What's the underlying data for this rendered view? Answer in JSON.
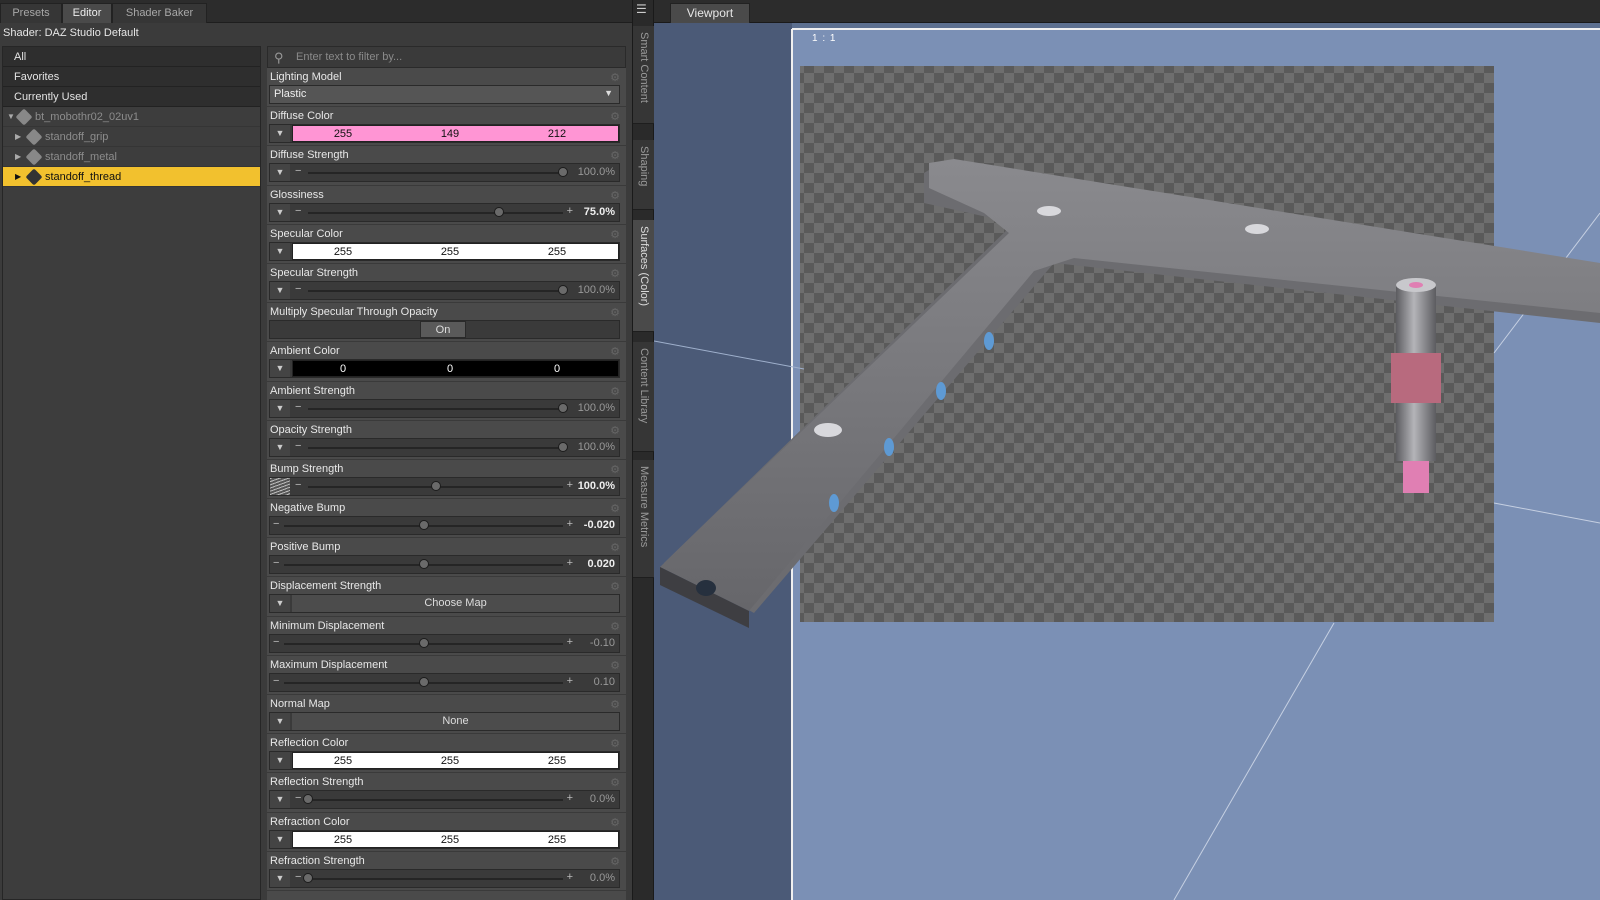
{
  "tabs": [
    "Presets",
    "Editor",
    "Shader Baker"
  ],
  "shader_label": "Shader: DAZ Studio Default",
  "categories": [
    "All",
    "Favorites",
    "Currently Used"
  ],
  "tree": [
    {
      "label": "bt_mobothr02_02uv1"
    },
    {
      "label": "standoff_grip"
    },
    {
      "label": "standoff_metal"
    },
    {
      "label": "standoff_thread"
    }
  ],
  "filter_placeholder": "Enter text to filter by...",
  "properties": {
    "lighting_model": {
      "label": "Lighting Model",
      "value": "Plastic"
    },
    "diffuse_color": {
      "label": "Diffuse Color",
      "r": "255",
      "g": "149",
      "b": "212",
      "color": "#ff95d4"
    },
    "diffuse_strength": {
      "label": "Diffuse Strength",
      "value": "100.0%",
      "level": 1.0
    },
    "glossiness": {
      "label": "Glossiness",
      "value": "75.0%",
      "level": 0.75
    },
    "specular_color": {
      "label": "Specular Color",
      "r": "255",
      "g": "255",
      "b": "255",
      "color": "#ffffff"
    },
    "specular_strength": {
      "label": "Specular Strength",
      "value": "100.0%",
      "level": 1.0
    },
    "multiply_specular": {
      "label": "Multiply Specular Through Opacity",
      "value": "On"
    },
    "ambient_color": {
      "label": "Ambient Color",
      "r": "0",
      "g": "0",
      "b": "0",
      "color": "#000000"
    },
    "ambient_strength": {
      "label": "Ambient Strength",
      "value": "100.0%",
      "level": 1.0
    },
    "opacity_strength": {
      "label": "Opacity Strength",
      "value": "100.0%",
      "level": 1.0
    },
    "bump_strength": {
      "label": "Bump Strength",
      "value": "100.0%",
      "level": 0.5
    },
    "negative_bump": {
      "label": "Negative Bump",
      "value": "-0.020",
      "level": 0.5
    },
    "positive_bump": {
      "label": "Positive Bump",
      "value": "0.020",
      "level": 0.5
    },
    "displacement_strength": {
      "label": "Displacement Strength",
      "value": "Choose Map"
    },
    "min_displacement": {
      "label": "Minimum Displacement",
      "value": "-0.10",
      "level": 0.5
    },
    "max_displacement": {
      "label": "Maximum Displacement",
      "value": "0.10",
      "level": 0.5
    },
    "normal_map": {
      "label": "Normal Map",
      "value": "None"
    },
    "reflection_color": {
      "label": "Reflection Color",
      "r": "255",
      "g": "255",
      "b": "255",
      "color": "#ffffff"
    },
    "reflection_strength": {
      "label": "Reflection Strength",
      "value": "0.0%",
      "level": 0.0
    },
    "refraction_color": {
      "label": "Refraction Color",
      "r": "255",
      "g": "255",
      "b": "255",
      "color": "#ffffff"
    },
    "refraction_strength": {
      "label": "Refraction Strength",
      "value": "0.0%",
      "level": 0.0
    }
  },
  "side_tabs": [
    "Smart Content",
    "Shaping",
    "Surfaces (Color)",
    "Content Library",
    "Measure Metrics"
  ],
  "viewport": {
    "tab": "Viewport",
    "ratio": "1 : 1"
  },
  "colors": {
    "selected": "#f2c12e",
    "viewport_bg": "#7b90b5",
    "accent_pink": "#ff95d4"
  }
}
